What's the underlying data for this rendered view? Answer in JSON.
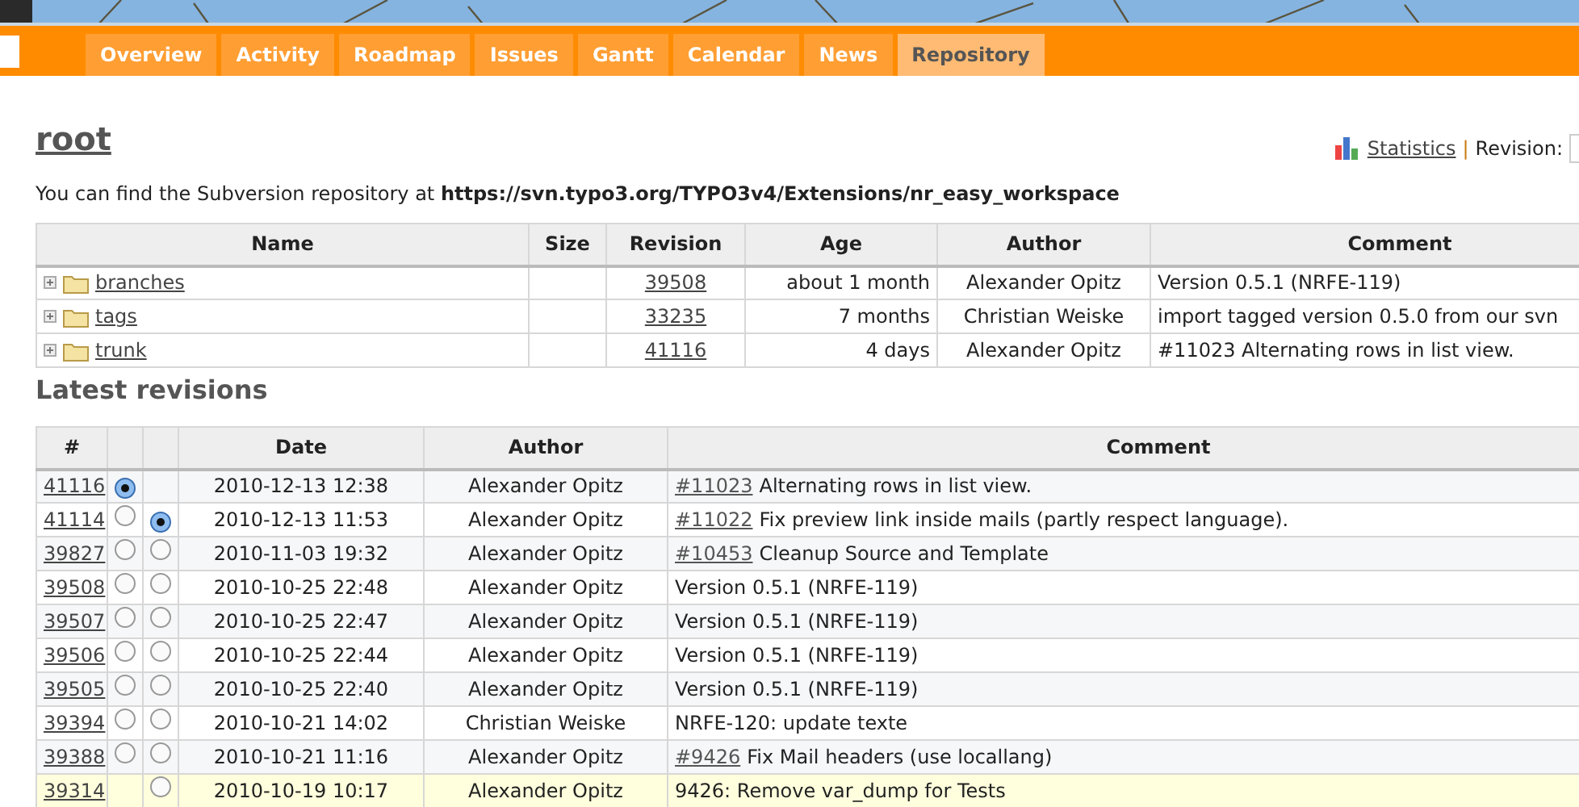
{
  "tabs": [
    {
      "label": "Overview",
      "selected": false
    },
    {
      "label": "Activity",
      "selected": false
    },
    {
      "label": "Roadmap",
      "selected": false
    },
    {
      "label": "Issues",
      "selected": false
    },
    {
      "label": "Gantt",
      "selected": false
    },
    {
      "label": "Calendar",
      "selected": false
    },
    {
      "label": "News",
      "selected": false
    },
    {
      "label": "Repository",
      "selected": true
    }
  ],
  "title": "root",
  "statistics_link": "Statistics",
  "separator": "|",
  "revision_label": "Revision:",
  "intro": "You can find the Subversion repository at **https://svn.typo3.org/TYPO3v4/Extensions/nr_easy_workspace**",
  "files": {
    "columns": [
      "Name",
      "Size",
      "Revision",
      "Age",
      "Author",
      "Comment"
    ],
    "rows": [
      {
        "name": "branches",
        "size": "",
        "revision": "39508",
        "age": "about 1 month",
        "author": "Alexander Opitz",
        "comment": "Version 0.5.1 (NRFE-119)"
      },
      {
        "name": "tags",
        "size": "",
        "revision": "33235",
        "age": "7 months",
        "author": "Christian Weiske",
        "comment": "import tagged version 0.5.0 from our svn"
      },
      {
        "name": "trunk",
        "size": "",
        "revision": "41116",
        "age": "4 days",
        "author": "Alexander Opitz",
        "comment": "#11023 Alternating rows in list view."
      }
    ]
  },
  "latest_heading": "Latest revisions",
  "revisions": {
    "columns": [
      "#",
      "",
      "",
      "Date",
      "Author",
      "Comment"
    ],
    "rows": [
      {
        "revision": "41116",
        "from": {
          "selected": true
        },
        "date": "2010-12-13 12:38",
        "author": "Alexander Opitz",
        "issue": "#11023",
        "comment": "Alternating rows in list view.",
        "highlighted": false
      },
      {
        "revision": "41114",
        "from": {
          "selected": false
        },
        "to": {
          "selected": true
        },
        "date": "2010-12-13 11:53",
        "author": "Alexander Opitz",
        "issue": "#11022",
        "comment": "Fix preview link inside mails (partly respect language).",
        "highlighted": false
      },
      {
        "revision": "39827",
        "from": {
          "selected": false
        },
        "to": {
          "selected": false
        },
        "date": "2010-11-03 19:32",
        "author": "Alexander Opitz",
        "issue": "#10453",
        "comment": "Cleanup Source and Template",
        "highlighted": false
      },
      {
        "revision": "39508",
        "from": {
          "selected": false
        },
        "to": {
          "selected": false
        },
        "date": "2010-10-25 22:48",
        "author": "Alexander Opitz",
        "comment": "Version 0.5.1 (NRFE-119)",
        "highlighted": false
      },
      {
        "revision": "39507",
        "from": {
          "selected": false
        },
        "to": {
          "selected": false
        },
        "date": "2010-10-25 22:47",
        "author": "Alexander Opitz",
        "comment": "Version 0.5.1 (NRFE-119)",
        "highlighted": false
      },
      {
        "revision": "39506",
        "from": {
          "selected": false
        },
        "to": {
          "selected": false
        },
        "date": "2010-10-25 22:44",
        "author": "Alexander Opitz",
        "comment": "Version 0.5.1 (NRFE-119)",
        "highlighted": false
      },
      {
        "revision": "39505",
        "from": {
          "selected": false
        },
        "to": {
          "selected": false
        },
        "date": "2010-10-25 22:40",
        "author": "Alexander Opitz",
        "comment": "Version 0.5.1 (NRFE-119)",
        "highlighted": false
      },
      {
        "revision": "39394",
        "from": {
          "selected": false
        },
        "to": {
          "selected": false
        },
        "date": "2010-10-21 14:02",
        "author": "Christian Weiske",
        "comment": "NRFE-120: update texte",
        "highlighted": false
      },
      {
        "revision": "39388",
        "from": {
          "selected": false
        },
        "to": {
          "selected": false
        },
        "date": "2010-10-21 11:16",
        "author": "Alexander Opitz",
        "issue": "#9426",
        "comment": "Fix Mail headers (use locallang)",
        "highlighted": false
      },
      {
        "revision": "39314",
        "to": {
          "selected": false
        },
        "date": "2010-10-19 10:17",
        "author": "Alexander Opitz",
        "comment": "9426: Remove var_dump for Tests",
        "highlighted": true
      }
    ]
  }
}
